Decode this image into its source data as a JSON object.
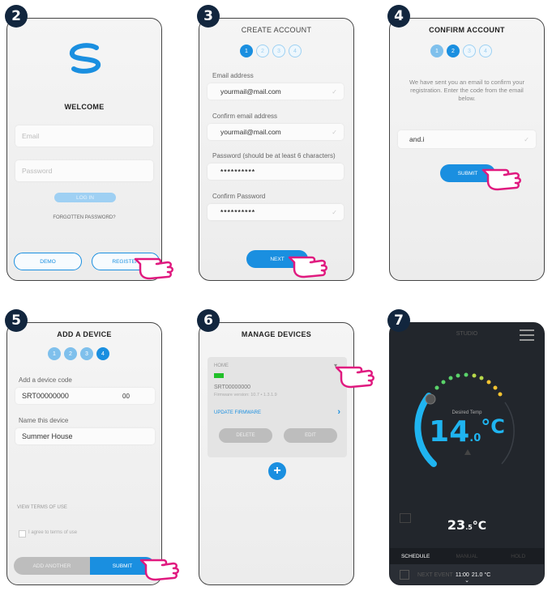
{
  "steps_numbers": [
    "2",
    "3",
    "4",
    "5",
    "6",
    "7"
  ],
  "p2": {
    "title": "WELCOME",
    "email_ph": "Email",
    "password_ph": "Password",
    "login_label": "LOG IN",
    "forgot": "FORGOTTEN PASSWORD?",
    "demo": "DEMO",
    "register": "REGISTER"
  },
  "p3": {
    "title": "CREATE ACCOUNT",
    "steps": [
      "1",
      "2",
      "3",
      "4"
    ],
    "email_label": "Email address",
    "email_value": "yourmail@mail.com",
    "confirm_email_label": "Confirm email address",
    "confirm_email_value": "yourmail@mail.com",
    "password_label": "Password (should be at least 6 characters)",
    "password_value": "**********",
    "confirm_password_label": "Confirm Password",
    "confirm_password_value": "**********",
    "next": "NEXT"
  },
  "p4": {
    "title": "CONFIRM ACCOUNT",
    "steps": [
      "1",
      "2",
      "3",
      "4"
    ],
    "message": "We have sent you an email to confirm your registration. Enter the code from the email below.",
    "code_value": "and.i",
    "submit": "SUBMIT"
  },
  "p5": {
    "title": "ADD A DEVICE",
    "steps": [
      "1",
      "2",
      "3",
      "4"
    ],
    "code_label": "Add a device code",
    "code_value": "SRT00000000",
    "code_suffix": "00",
    "name_label": "Name this device",
    "name_value": "Summer House",
    "terms": "VIEW TERMS OF USE",
    "agree": "I agree to terms of use",
    "add_another": "ADD ANOTHER",
    "submit": "SUBMIT"
  },
  "p6": {
    "title": "MANAGE DEVICES",
    "home": "HOME",
    "online": "ON",
    "serial": "SRT00000000",
    "firmware": "Firmware version: 10.7 • 1.3.1.9",
    "update": "UPDATE FIRMWARE",
    "delete": "DELETE",
    "edit": "EDIT",
    "add": "+"
  },
  "p7": {
    "header": "STUDIO",
    "desired_label": "Desired Temp",
    "temp_int": "14",
    "temp_dec": ".0",
    "unit": "°C",
    "current_int": "23",
    "current_dec": ".5",
    "current_unit": "°C",
    "tabs": [
      "SCHEDULE",
      "MANUAL",
      "HOLD"
    ],
    "next_event_label": "NEXT EVENT",
    "next_time": "11:00",
    "next_temp": "21.0 °C",
    "colors": {
      "bg": "#22262c",
      "accent": "#1fb4f0",
      "warm": "#f5c431"
    }
  }
}
